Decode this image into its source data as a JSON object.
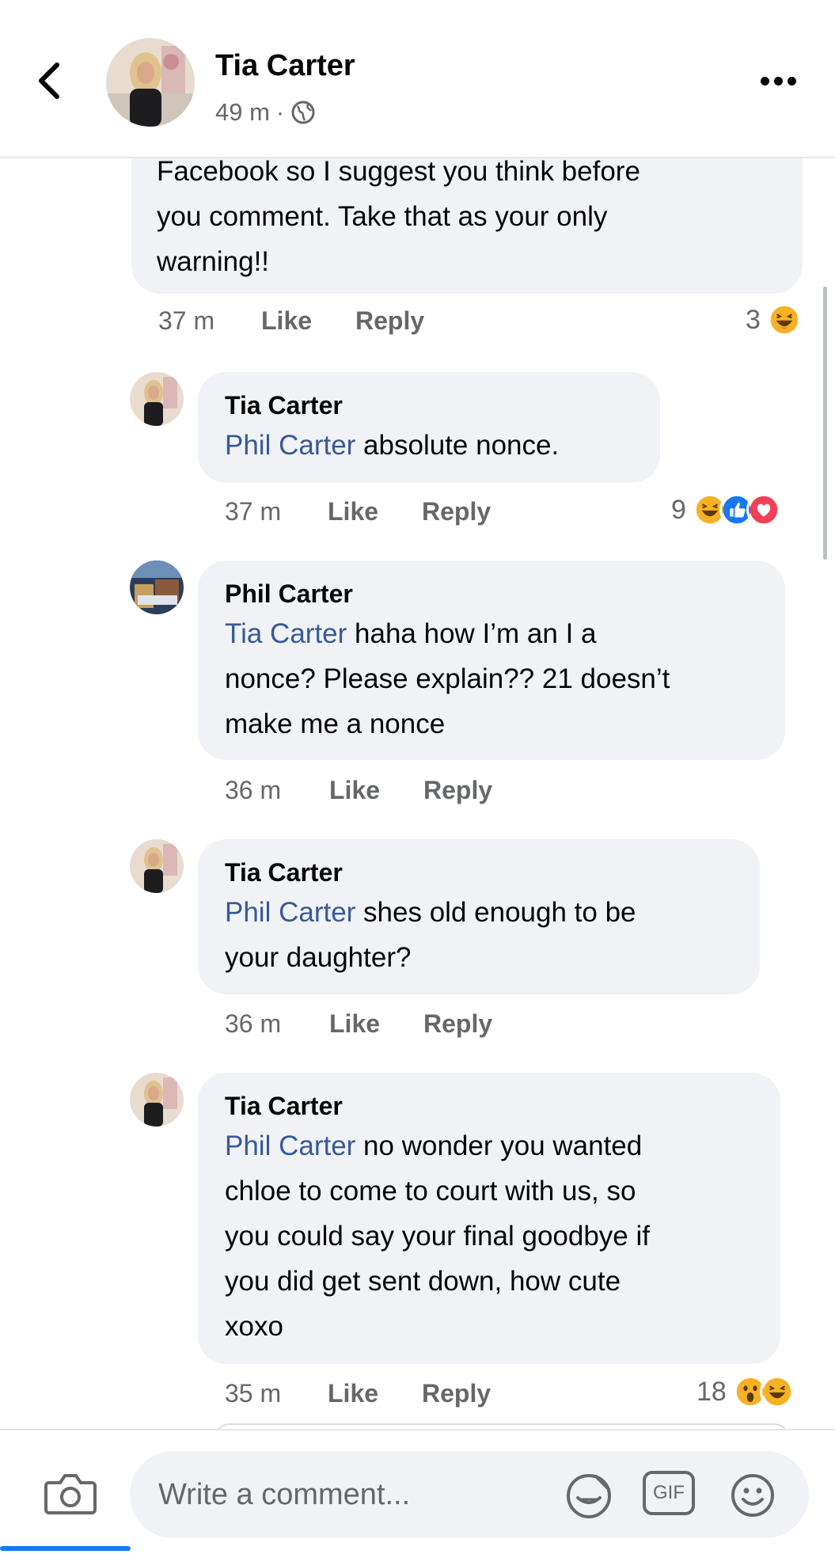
{
  "header": {
    "name": "Tia Carter",
    "time": "49 m",
    "separator": "·",
    "privacy_icon": "globe-icon"
  },
  "comments": [
    {
      "id": "c0",
      "author": "",
      "mention": "",
      "text_lines": [
        "Facebook so I suggest you think before",
        "you comment. Take that as your only",
        "warning!!"
      ],
      "time": "37 m",
      "like": "Like",
      "reply": "Reply",
      "reaction_count": "3",
      "reactions": [
        "haha"
      ]
    },
    {
      "id": "c1",
      "author": "Tia Carter",
      "mention": "Phil Carter",
      "text_after_mention": " absolute nonce.",
      "time": "37 m",
      "like": "Like",
      "reply": "Reply",
      "reaction_count": "9",
      "reactions": [
        "haha",
        "like",
        "love"
      ]
    },
    {
      "id": "c2",
      "author": "Phil Carter",
      "mention": "Tia Carter",
      "text_after_mention": " haha how I’m an I a",
      "text_lines": [
        "nonce? Please explain?? 21 doesn’t",
        "make me a nonce"
      ],
      "time": "36 m",
      "like": "Like",
      "reply": "Reply"
    },
    {
      "id": "c3",
      "author": "Tia Carter",
      "mention": "Phil Carter",
      "text_after_mention": " shes old enough to be",
      "text_lines": [
        "your daughter?"
      ],
      "time": "36 m",
      "like": "Like",
      "reply": "Reply"
    },
    {
      "id": "c4",
      "author": "Tia Carter",
      "mention": "Phil Carter",
      "text_after_mention": " no wonder you wanted",
      "text_lines": [
        "chloe to come to court with us, so",
        "you could say your final goodbye if",
        "you did get sent down, how cute",
        "xoxo"
      ],
      "time": "35 m",
      "like": "Like",
      "reply": "Reply",
      "reaction_count": "18",
      "reactions": [
        "wow",
        "haha"
      ]
    }
  ],
  "composer": {
    "placeholder": "Write a comment...",
    "camera_icon": "camera-icon",
    "sticker_icon": "sticker-icon",
    "gif_label": "GIF",
    "emoji_icon": "emoji-icon"
  },
  "colors": {
    "mention": "#385898",
    "meta": "#65676b",
    "bubble": "#f0f2f5",
    "like_blue": "#1877f2",
    "love_red": "#f33e58",
    "haha_yellow": "#f7b125"
  }
}
